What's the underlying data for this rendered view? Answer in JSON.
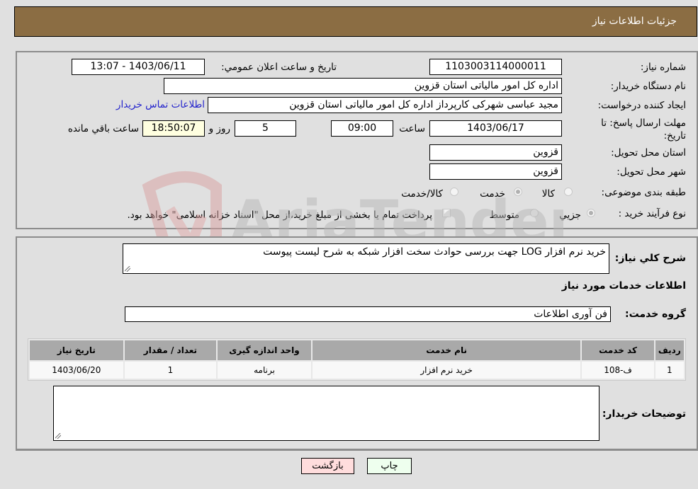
{
  "header": {
    "title": "جزئیات اطلاعات نیاز"
  },
  "form": {
    "need_number_label": "شماره نیاز:",
    "need_number": "1103003114000011",
    "announce_label": "تاريخ و ساعت اعلان عمومي:",
    "announce_value": "1403/06/11 - 13:07",
    "buyer_org_label": "نام دستگاه خريدار:",
    "buyer_org": "اداره کل امور مالیاتی استان قزوین",
    "creator_label": "ايجاد کننده درخواست:",
    "creator": "مجید عباسی شهرکی کارپرداز اداره کل امور مالیاتی استان قزوین",
    "contact_link": "اطلاعات تماس خريدار",
    "deadline_label": "مهلت ارسال پاسخ: تا تاريخ:",
    "deadline_date": "1403/06/17",
    "time_label": "ساعت",
    "deadline_time": "09:00",
    "days_value": "5",
    "days_label": "روز و",
    "remaining_time": "18:50:07",
    "remaining_label": "ساعت باقي مانده",
    "province_label": "استان محل تحويل:",
    "province": "قزوين",
    "city_label": "شهر محل تحويل:",
    "city": "قزوين",
    "category_label": "طبقه بندی موضوعی:",
    "category_options": [
      {
        "label": "كالا",
        "checked": false
      },
      {
        "label": "خدمت",
        "checked": true
      },
      {
        "label": "كالا/خدمت",
        "checked": false
      }
    ],
    "process_label": "نوع فرآيند خريد :",
    "process_options": [
      {
        "label": "جزيي",
        "checked": true
      },
      {
        "label": "متوسط",
        "checked": false
      }
    ],
    "treasury_checkbox_label": "پرداخت تمام يا بخشی از مبلغ خريد،از محل \"اسناد خزانه اسلامی\" خواهد بود.",
    "treasury_checked": false
  },
  "details": {
    "summary_label": "شرح کلي نياز:",
    "summary": "خرید نرم افزار LOG جهت بررسی حوادث سخت افزار شبکه به شرح لیست پیوست",
    "services_heading": "اطلاعات خدمات مورد نياز",
    "service_group_label": "گروه خدمت:",
    "service_group": "فن آوری اطلاعات",
    "table": {
      "headers": [
        "رديف",
        "کد خدمت",
        "نام خدمت",
        "واحد اندازه گيری",
        "تعداد / مقدار",
        "تاريخ نياز"
      ],
      "rows": [
        [
          "1",
          "ف-108",
          "خريد نرم افزار",
          "برنامه",
          "1",
          "1403/06/20"
        ]
      ]
    },
    "buyer_notes_label": "توضيحات خريدار:",
    "buyer_notes": ""
  },
  "buttons": {
    "print": "چاپ",
    "back": "بازگشت"
  },
  "colors": {
    "header_bg": "#8b6d43",
    "print_bg": "#eeffee",
    "back_bg": "#ffdddd",
    "link": "#2323cc"
  }
}
